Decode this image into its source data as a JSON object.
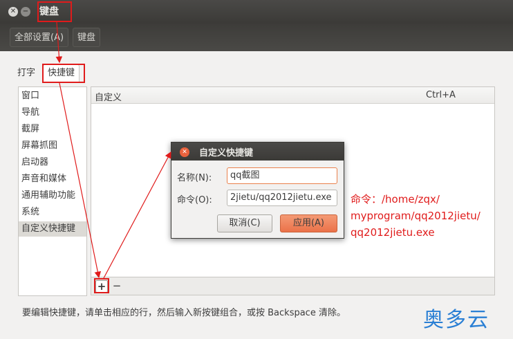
{
  "window": {
    "title": "键盘"
  },
  "toolbar": {
    "all_settings_label": "全部设置(A)",
    "keyboard_label": "键盘"
  },
  "tabs": [
    {
      "label": "打字"
    },
    {
      "label": "快捷键"
    }
  ],
  "categories": [
    {
      "label": "窗口"
    },
    {
      "label": "导航"
    },
    {
      "label": "截屏"
    },
    {
      "label": "屏幕抓图"
    },
    {
      "label": "启动器"
    },
    {
      "label": "声音和媒体"
    },
    {
      "label": "通用辅助功能"
    },
    {
      "label": "系统"
    },
    {
      "label": "自定义快捷键",
      "selected": true
    }
  ],
  "shortcut_table": {
    "rows": [
      {
        "name": "自定义",
        "accelerator": "Ctrl+A"
      }
    ]
  },
  "add_remove": {
    "add_label": "+",
    "remove_label": "−"
  },
  "hint": "要编辑快捷键，请单击相应的行，然后输入新按键组合，或按 Backspace 清除。",
  "dialog": {
    "title": "自定义快捷键",
    "name_label": "名称(N):",
    "name_value": "qq截图",
    "command_label": "命令(O):",
    "command_value": "2jietu/qq2012jietu.exe",
    "cancel_label": "取消(C)",
    "apply_label": "应用(A)"
  },
  "annotation": {
    "line1": "命令：/home/zqx/",
    "line2": "myprogram/qq2012jietu/",
    "line3": "qq2012jietu.exe",
    "color": "#e01b1b"
  },
  "watermark": "奥多云"
}
